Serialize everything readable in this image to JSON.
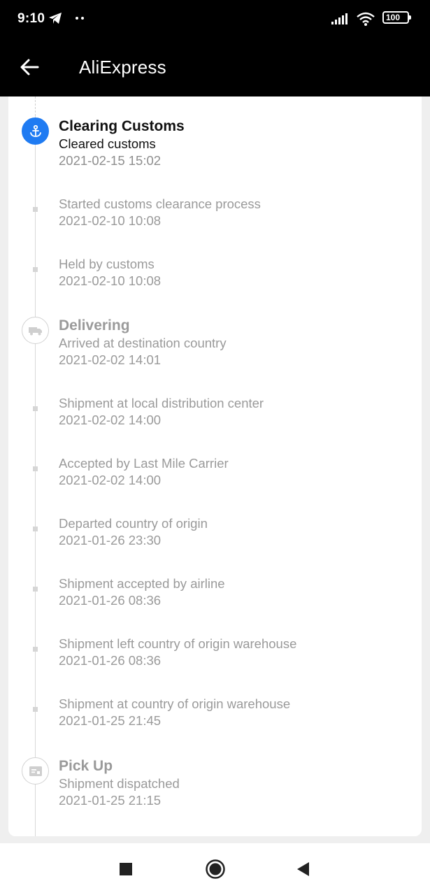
{
  "status_bar": {
    "time": "9:10",
    "dots": "••",
    "battery": "100",
    "icons": [
      "telegram-icon",
      "signal-icon",
      "wifi-icon",
      "battery-icon"
    ]
  },
  "app_bar": {
    "title": "AliExpress",
    "back_icon": "arrow-left-icon"
  },
  "colors": {
    "accent": "#1f7bf2",
    "inactive_text": "#9a9a9a",
    "active_text": "#111111"
  },
  "timeline": [
    {
      "stage": "Clearing Customs",
      "description": "Cleared customs",
      "time": "2021-02-15 15:02",
      "icon": "anchor-icon",
      "active": true
    },
    {
      "stage": "",
      "description": "Started customs clearance process",
      "time": "2021-02-10 10:08"
    },
    {
      "stage": "",
      "description": "Held by customs",
      "time": "2021-02-10 10:08"
    },
    {
      "stage": "Delivering",
      "description": "Arrived at destination country",
      "time": "2021-02-02 14:01",
      "icon": "truck-icon"
    },
    {
      "stage": "",
      "description": "Shipment at local distribution center",
      "time": "2021-02-02 14:00"
    },
    {
      "stage": "",
      "description": "Accepted by Last Mile Carrier",
      "time": "2021-02-02 14:00"
    },
    {
      "stage": "",
      "description": "Departed country of origin",
      "time": "2021-01-26 23:30"
    },
    {
      "stage": "",
      "description": "Shipment accepted by airline",
      "time": "2021-01-26 08:36"
    },
    {
      "stage": "",
      "description": "Shipment left country of origin warehouse",
      "time": "2021-01-26 08:36"
    },
    {
      "stage": "",
      "description": "Shipment at country of origin warehouse",
      "time": "2021-01-25 21:45"
    },
    {
      "stage": "Pick Up",
      "description": "Shipment dispatched",
      "time": "2021-01-25 21:15",
      "icon": "package-icon"
    }
  ],
  "nav_bar": {
    "buttons": [
      "recents-icon",
      "home-icon",
      "back-triangle-icon"
    ]
  }
}
